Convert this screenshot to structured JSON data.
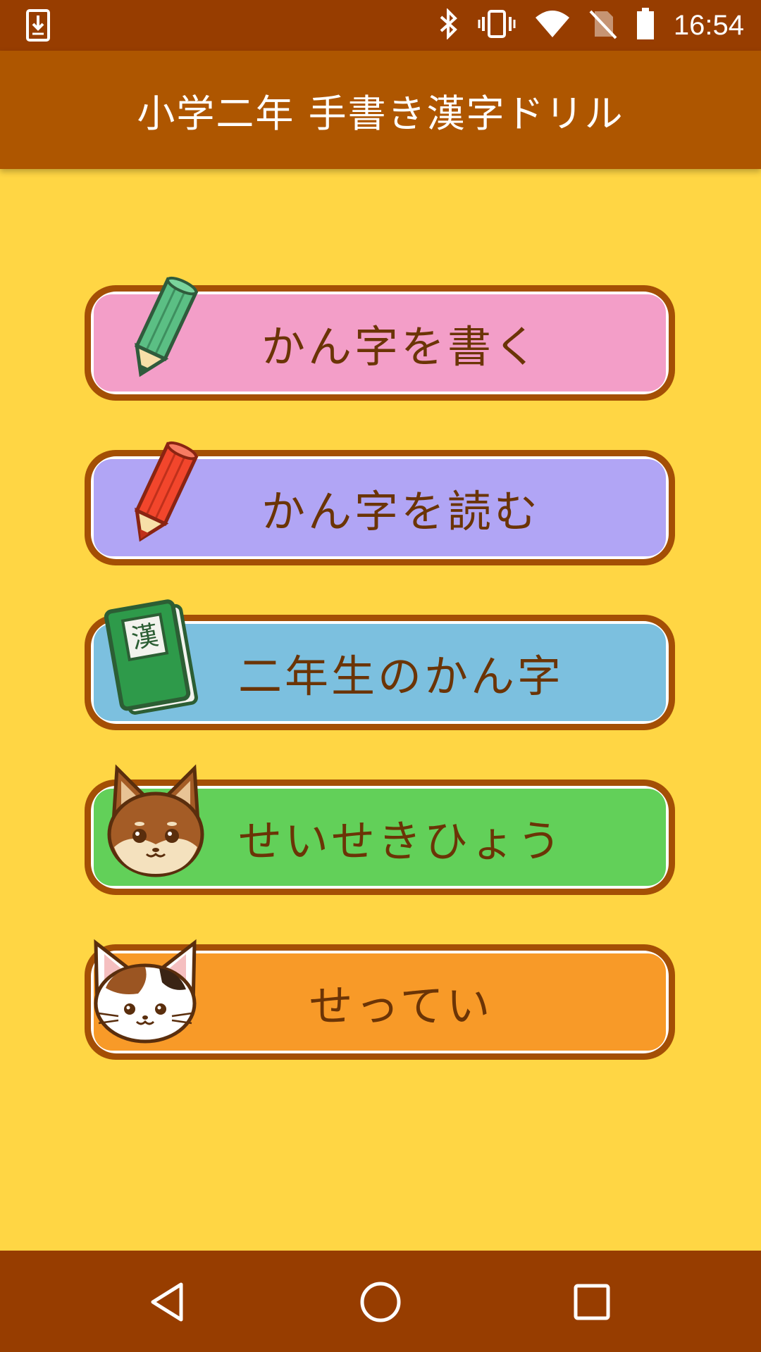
{
  "status_bar": {
    "time": "16:54",
    "icons": [
      "download-notification-icon",
      "bluetooth-icon",
      "vibrate-icon",
      "wifi-icon",
      "no-sim-icon",
      "battery-icon"
    ]
  },
  "app_bar": {
    "title": "小学二年 手書き漢字ドリル"
  },
  "menu": [
    {
      "label": "かん字を書く",
      "color": "#F39EC8",
      "icon": "green-pencil-icon"
    },
    {
      "label": "かん字を読む",
      "color": "#B1A5F5",
      "icon": "red-pencil-icon"
    },
    {
      "label": "二年生のかん字",
      "color": "#7CC0DF",
      "icon": "kanji-book-icon",
      "icon_text": "漢"
    },
    {
      "label": "せいせきひょう",
      "color": "#62D059",
      "icon": "shiba-dog-icon"
    },
    {
      "label": "せってい",
      "color": "#F89A28",
      "icon": "calico-cat-icon"
    }
  ],
  "colors": {
    "background": "#FFD644",
    "status_bar": "#973D00",
    "app_bar": "#AE5600",
    "button_border": "#A44F05",
    "label_text": "#6B3406"
  },
  "nav_bar": {
    "icons": [
      "back-icon",
      "home-icon",
      "recents-icon"
    ]
  }
}
